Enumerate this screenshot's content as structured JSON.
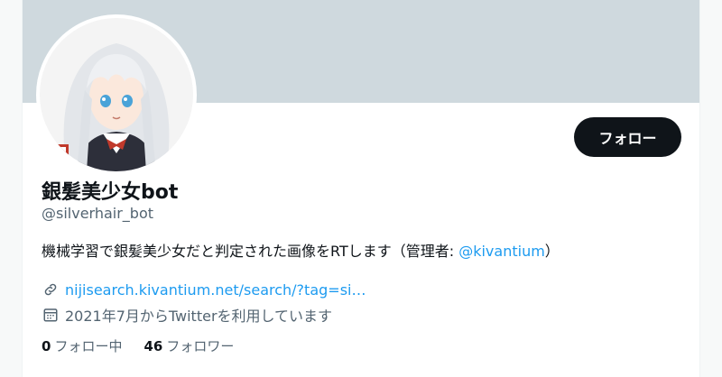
{
  "profile": {
    "display_name": "銀髪美少女bot",
    "handle": "@silverhair_bot",
    "bio_text": "機械学習で銀髪美少女だと判定された画像をRTします（管理者: ",
    "bio_mention": "@kivantium",
    "bio_suffix": "）",
    "link_text": "nijisearch.kivantium.net/search/?tag=si…",
    "joined_text": "2021年7月からTwitterを利用しています",
    "follow_button_label": "フォロー"
  },
  "stats": {
    "following_count": "0",
    "following_label": "フォロー中",
    "followers_count": "46",
    "followers_label": "フォロワー"
  },
  "icons": {
    "link": "link-icon",
    "calendar": "calendar-icon"
  },
  "colors": {
    "banner": "#cfd9de",
    "accent": "#1d9bf0",
    "button_bg": "#0f1419",
    "secondary_text": "#536471"
  }
}
